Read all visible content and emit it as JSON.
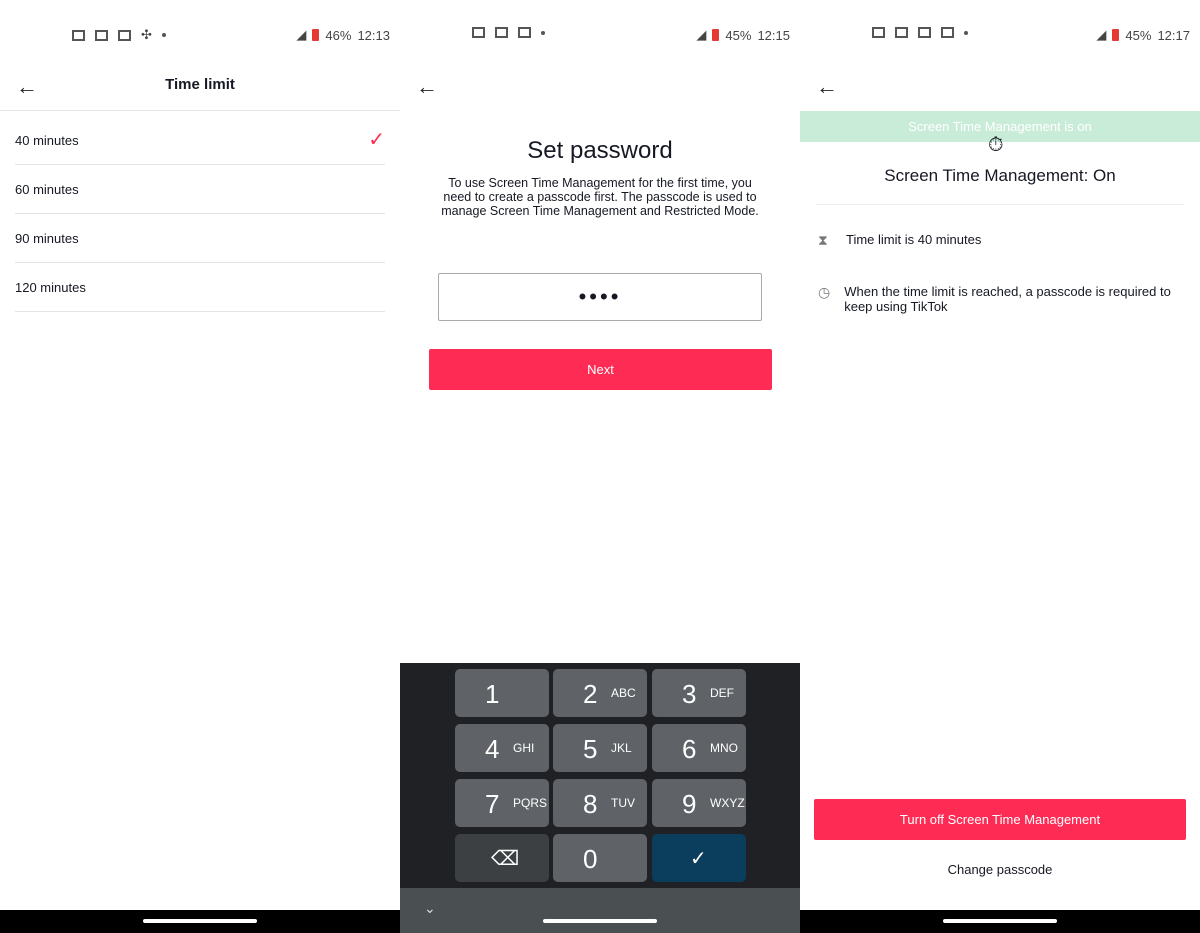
{
  "panels": [
    {
      "status": {
        "battery": "46%",
        "time": "12:13"
      },
      "title": "Time limit",
      "options": [
        "40 minutes",
        "60 minutes",
        "90 minutes",
        "120 minutes"
      ],
      "selected": "40 minutes"
    },
    {
      "status": {
        "battery": "45%",
        "time": "12:15"
      },
      "heading": "Set password",
      "description": "To use Screen Time Management for the first time, you need to create a passcode first. The passcode is used to manage Screen Time Management and Restricted Mode.",
      "password_value": "••••",
      "next_label": "Next",
      "keypad": [
        {
          "n": "1",
          "l": ""
        },
        {
          "n": "2",
          "l": "ABC"
        },
        {
          "n": "3",
          "l": "DEF"
        },
        {
          "n": "4",
          "l": "GHI"
        },
        {
          "n": "5",
          "l": "JKL"
        },
        {
          "n": "6",
          "l": "MNO"
        },
        {
          "n": "7",
          "l": "PQRS"
        },
        {
          "n": "8",
          "l": "TUV"
        },
        {
          "n": "9",
          "l": "WXYZ"
        },
        {
          "n": "0",
          "l": ""
        }
      ],
      "keyboard_accent": "#0b3d5c"
    },
    {
      "status": {
        "battery": "45%",
        "time": "12:17"
      },
      "banner": "Screen Time Management is on",
      "heading": "Screen Time Management: On",
      "info": [
        "Time limit is 40 minutes",
        "When the time limit is reached, a passcode is required to keep using TikTok"
      ],
      "turn_off_label": "Turn off Screen Time Management",
      "change_passcode_label": "Change passcode"
    }
  ],
  "colors": {
    "accent": "#fe2c55",
    "banner": "#c8ecd8"
  }
}
